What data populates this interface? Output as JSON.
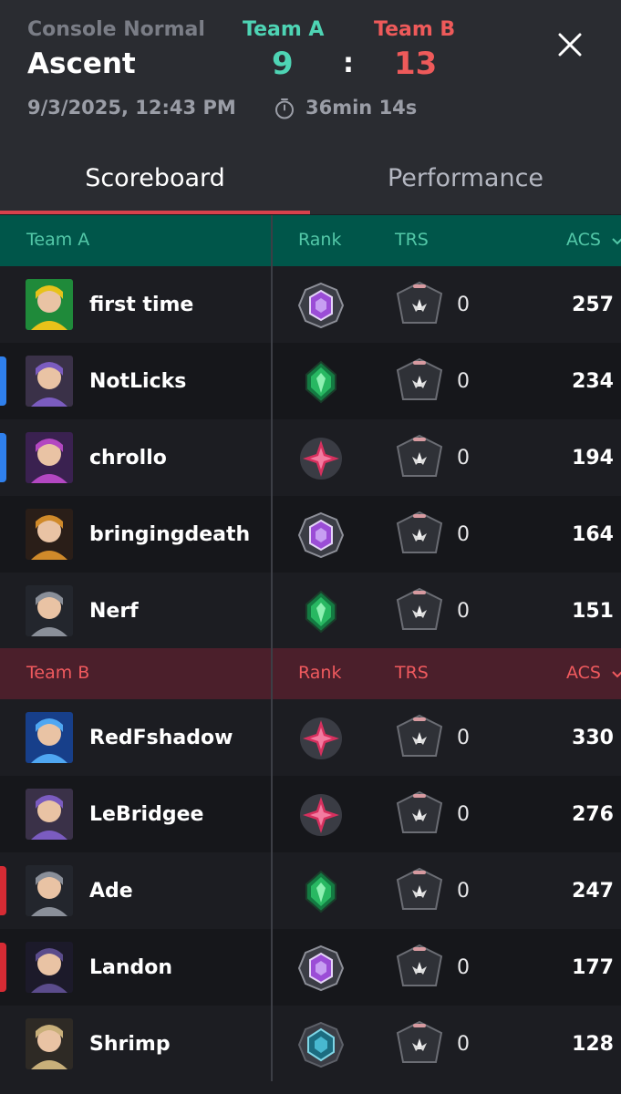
{
  "match": {
    "mode": "Console Normal",
    "map": "Ascent",
    "datetime": "9/3/2025, 12:43 PM",
    "duration": "36min 14s",
    "team_a_name": "Team A",
    "team_b_name": "Team B",
    "score_a": "9",
    "score_separator": ":",
    "score_b": "13"
  },
  "tabs": {
    "scoreboard": "Scoreboard",
    "performance": "Performance",
    "active": "scoreboard"
  },
  "columns": {
    "rank": "Rank",
    "trs": "TRS",
    "acs": "ACS",
    "sort_icon": "chevron-down-icon"
  },
  "team_a": {
    "name": "Team A",
    "players": [
      {
        "name": "first time",
        "rank_icon": "purple-rank-icon",
        "trs": "0",
        "acs": "257"
      },
      {
        "name": "NotLicks",
        "rank_icon": "green-rank-icon",
        "trs": "0",
        "acs": "234",
        "party": "blue"
      },
      {
        "name": "chrollo",
        "rank_icon": "pink-rank-icon",
        "trs": "0",
        "acs": "194",
        "party": "blue"
      },
      {
        "name": "bringingdeath",
        "rank_icon": "purple-rank-icon",
        "trs": "0",
        "acs": "164"
      },
      {
        "name": "Nerf",
        "rank_icon": "green-rank-icon",
        "trs": "0",
        "acs": "151"
      }
    ]
  },
  "team_b": {
    "name": "Team B",
    "players": [
      {
        "name": "RedFshadow",
        "rank_icon": "pink-rank-icon",
        "trs": "0",
        "acs": "330"
      },
      {
        "name": "LeBridgee",
        "rank_icon": "pink-rank-icon",
        "trs": "0",
        "acs": "276"
      },
      {
        "name": "Ade",
        "rank_icon": "green-rank-icon",
        "trs": "0",
        "acs": "247",
        "party": "red"
      },
      {
        "name": "Landon",
        "rank_icon": "purple-rank-icon",
        "trs": "0",
        "acs": "177",
        "party": "red"
      },
      {
        "name": "Shrimp",
        "rank_icon": "teal-rank-icon",
        "trs": "0",
        "acs": "128"
      }
    ]
  },
  "colors": {
    "team_a": "#4ed4b4",
    "team_b": "#ee5a5a",
    "team_a_header_bg": "#00564a",
    "team_b_header_bg": "#4b1f2b",
    "tab_underline": "#d8414c",
    "party_blue": "#2f80ed",
    "party_red": "#d62b34"
  }
}
